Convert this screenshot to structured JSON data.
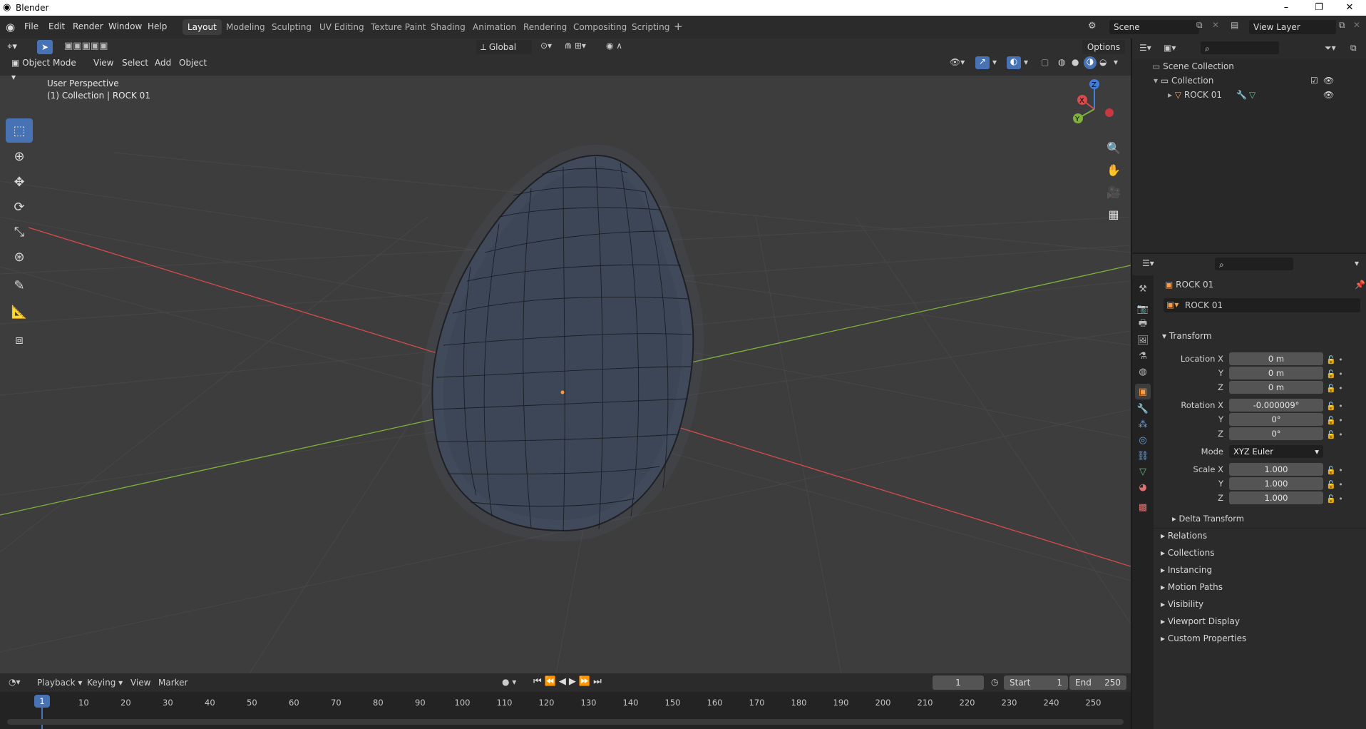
{
  "app": {
    "title": "Blender"
  },
  "window_controls": {
    "minimize": "–",
    "maximize": "❐",
    "close": "✕"
  },
  "menu": [
    "File",
    "Edit",
    "Render",
    "Window",
    "Help"
  ],
  "workspaces": [
    "Layout",
    "Modeling",
    "Sculpting",
    "UV Editing",
    "Texture Paint",
    "Shading",
    "Animation",
    "Rendering",
    "Compositing",
    "Scripting"
  ],
  "scene": {
    "name": "Scene",
    "view_layer": "View Layer"
  },
  "viewport": {
    "mode": "Object Mode",
    "menus": [
      "View",
      "Select",
      "Add",
      "Object"
    ],
    "orientation": "Global",
    "options": "Options",
    "perspective_label": "User Perspective",
    "collection_label": "(1) Collection | ROCK 01",
    "gizmo": {
      "x": "X",
      "y": "Y",
      "z": "Z"
    }
  },
  "outliner": {
    "root": "Scene Collection",
    "collection": "Collection",
    "object": "ROCK 01"
  },
  "properties": {
    "object_name": "ROCK 01",
    "data_name": "ROCK 01",
    "transform_title": "Transform",
    "location": {
      "label": "Location X",
      "x": "0 m",
      "y": "0 m",
      "z": "0 m"
    },
    "rotation": {
      "label": "Rotation X",
      "x": "-0.000009°",
      "y": "0°",
      "z": "0°"
    },
    "axis_y": "Y",
    "axis_z": "Z",
    "mode_label": "Mode",
    "mode_value": "XYZ Euler",
    "scale": {
      "label": "Scale X",
      "x": "1.000",
      "y": "1.000",
      "z": "1.000"
    },
    "delta_transform": "Delta Transform",
    "panels": [
      "Relations",
      "Collections",
      "Instancing",
      "Motion Paths",
      "Visibility",
      "Viewport Display",
      "Custom Properties"
    ]
  },
  "timeline": {
    "menus": [
      "Playback",
      "Keying",
      "View",
      "Marker"
    ],
    "current_frame": "1",
    "start_label": "Start",
    "start": "1",
    "end_label": "End",
    "end": "250",
    "ticks": [
      "10",
      "20",
      "30",
      "40",
      "50",
      "60",
      "70",
      "80",
      "90",
      "100",
      "110",
      "120",
      "130",
      "140",
      "150",
      "160",
      "170",
      "180",
      "190",
      "200",
      "210",
      "220",
      "230",
      "240",
      "250"
    ]
  },
  "colors": {
    "accent": "#4772b3",
    "x_axis": "#d64b4b",
    "y_axis": "#7fb13c",
    "z_axis": "#3f7fd9",
    "viewport_bg": "#3d3d3d"
  }
}
